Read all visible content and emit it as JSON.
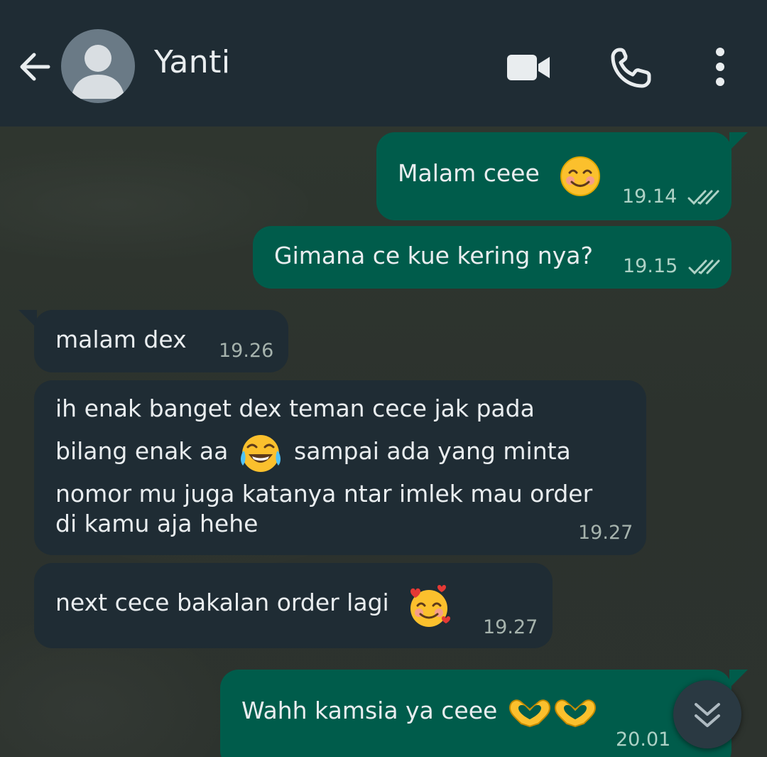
{
  "header": {
    "contact_name": "Yanti",
    "icons": [
      "back-arrow-icon",
      "avatar-placeholder-icon",
      "video-call-icon",
      "phone-call-icon",
      "more-vert-icon"
    ]
  },
  "messages": [
    {
      "direction": "outgoing",
      "text": "Malam ceee",
      "emoji": "smiling-face-icon",
      "time": "19.14",
      "status": "read"
    },
    {
      "direction": "outgoing",
      "text": "Gimana ce kue kering nya?",
      "time": "19.15",
      "status": "read"
    },
    {
      "direction": "incoming",
      "text": "malam dex",
      "time": "19.26"
    },
    {
      "direction": "incoming",
      "lines": [
        "ih enak banget dex teman cece jak pada",
        "bilang enak aa",
        "sampai ada yang minta",
        "nomor mu juga katanya ntar imlek mau order",
        "di kamu aja hehe"
      ],
      "emoji": "tears-of-joy-icon",
      "time": "19.27"
    },
    {
      "direction": "incoming",
      "text": "next cece bakalan order lagi",
      "emoji": "smiling-face-hearts-icon",
      "time": "19.27"
    },
    {
      "direction": "outgoing",
      "text": "Wahh kamsia ya ceee",
      "emoji": "heart-hands-icon",
      "time": "20.01"
    }
  ],
  "colors": {
    "header_bg": "#1f2c34",
    "outgoing_bubble": "#005c4b",
    "incoming_bubble": "#1f2c34",
    "read_tick": "#aed2c6"
  }
}
